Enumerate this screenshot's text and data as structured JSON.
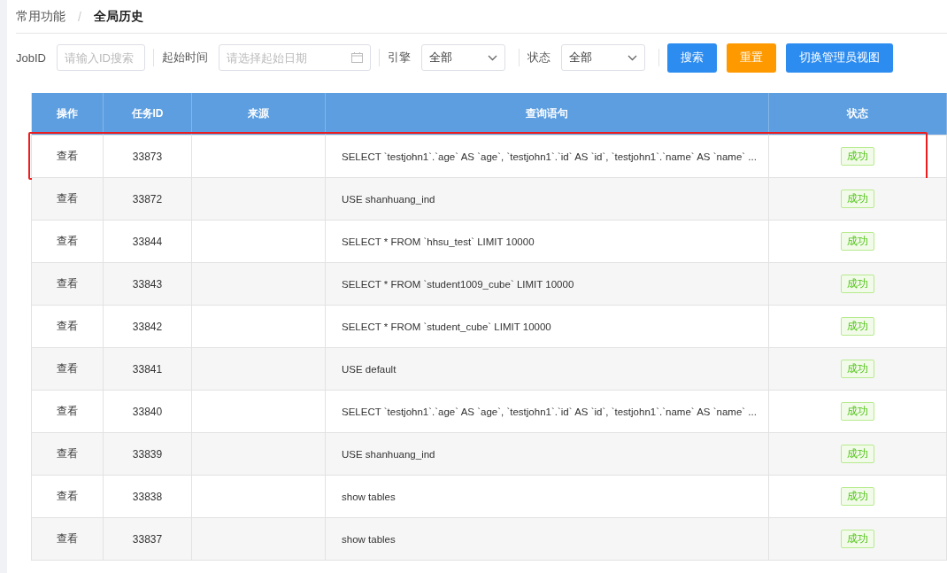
{
  "breadcrumb": [
    {
      "label": "常用功能",
      "current": false
    },
    {
      "label": "全局历史",
      "current": true
    }
  ],
  "breadcrumb_separator": "/",
  "filters": [
    {
      "kind": "input",
      "label": "JobID",
      "placeholder": "请输入ID搜索"
    },
    {
      "kind": "date",
      "label": "起始时间",
      "placeholder": "请选择起始日期"
    },
    {
      "kind": "select",
      "label": "引擎",
      "value": "全部"
    },
    {
      "kind": "select",
      "label": "状态",
      "value": "全部"
    }
  ],
  "buttons": [
    {
      "label": "搜索",
      "kind": "primary"
    },
    {
      "label": "重置",
      "kind": "warning"
    },
    {
      "label": "切换管理员视图",
      "kind": "primary"
    }
  ],
  "table": {
    "columns": [
      "操作",
      "任务ID",
      "来源",
      "查询语句",
      "状态"
    ],
    "rows": [
      {
        "action": "查看",
        "id": "33873",
        "query": "SELECT `testjohn1`.`age` AS `age`, `testjohn1`.`id` AS `id`, `testjohn1`.`name` AS `name` ...",
        "status": "成功",
        "highlighted": true
      },
      {
        "action": "查看",
        "id": "33872",
        "query": "USE shanhuang_ind",
        "status": "成功",
        "highlighted": false
      },
      {
        "action": "查看",
        "id": "33844",
        "query": "SELECT * FROM `hhsu_test` LIMIT 10000",
        "status": "成功",
        "highlighted": false
      },
      {
        "action": "查看",
        "id": "33843",
        "query": "SELECT * FROM `student1009_cube` LIMIT 10000",
        "status": "成功",
        "highlighted": false
      },
      {
        "action": "查看",
        "id": "33842",
        "query": "SELECT * FROM `student_cube` LIMIT 10000",
        "status": "成功",
        "highlighted": false
      },
      {
        "action": "查看",
        "id": "33841",
        "query": "USE default",
        "status": "成功",
        "highlighted": false
      },
      {
        "action": "查看",
        "id": "33840",
        "query": "SELECT `testjohn1`.`age` AS `age`, `testjohn1`.`id` AS `id`, `testjohn1`.`name` AS `name` ...",
        "status": "成功",
        "highlighted": false
      },
      {
        "action": "查看",
        "id": "33839",
        "query": "USE shanhuang_ind",
        "status": "成功",
        "highlighted": false
      },
      {
        "action": "查看",
        "id": "33838",
        "query": "show tables",
        "status": "成功",
        "highlighted": false
      },
      {
        "action": "查看",
        "id": "33837",
        "query": "show tables",
        "status": "成功",
        "highlighted": false
      }
    ]
  }
}
